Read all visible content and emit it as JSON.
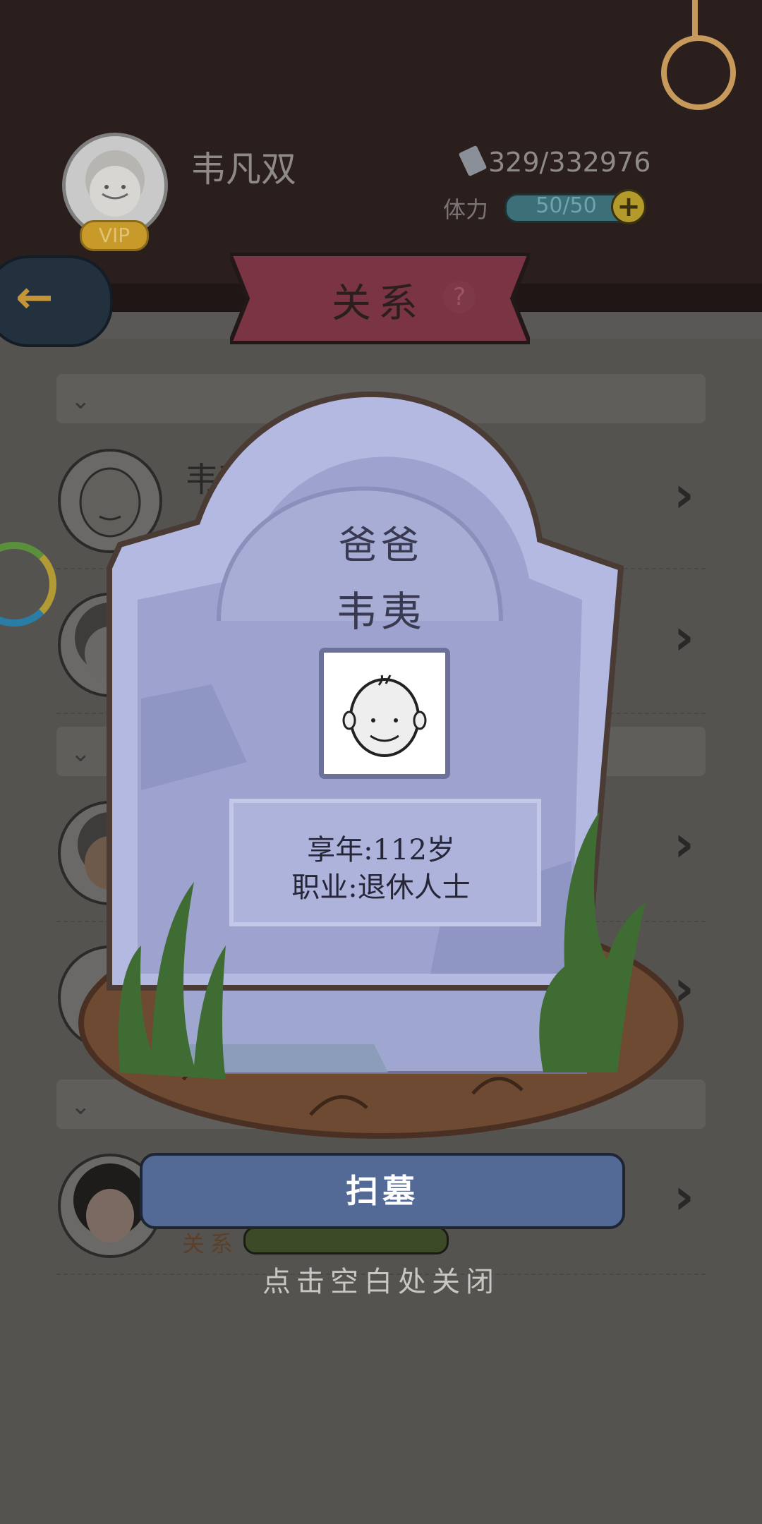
{
  "header": {
    "player_name": "韦凡双",
    "vip_label": "VIP",
    "coins": "329/332976",
    "stamina_label": "体力",
    "stamina_value": "50/50",
    "plus_symbol": "+"
  },
  "title": {
    "text": "关系",
    "help_symbol": "?"
  },
  "list": {
    "rows": [
      {
        "name": "韦夷"
      }
    ],
    "relation_label": "关系"
  },
  "tombstone": {
    "relation": "爸爸",
    "name": "韦夷",
    "age_line": "享年:112岁",
    "job_line": "职业:退休人士"
  },
  "actions": {
    "sweep_label": "扫墓",
    "close_hint": "点击空白处关闭"
  },
  "colors": {
    "stone": "#a9b0d8",
    "stone_dark": "#8d92ba",
    "button": "#536a96",
    "banner": "#7a3444"
  }
}
